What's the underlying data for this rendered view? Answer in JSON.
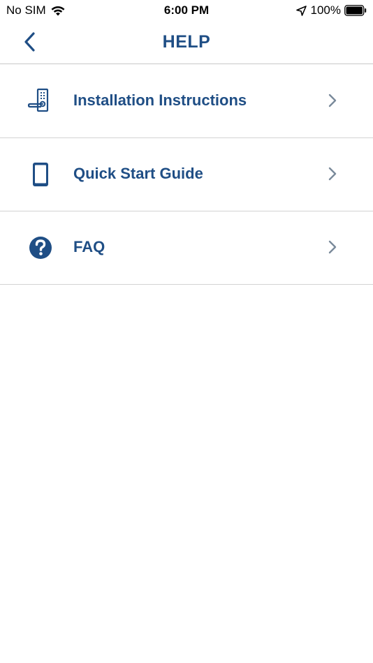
{
  "status_bar": {
    "carrier": "No SIM",
    "time": "6:00 PM",
    "battery": "100%"
  },
  "nav": {
    "title": "HELP",
    "back_icon": "chevron-left-icon"
  },
  "items": [
    {
      "label": "Installation Instructions",
      "icon": "door-lock-icon"
    },
    {
      "label": "Quick Start Guide",
      "icon": "smartphone-icon"
    },
    {
      "label": "FAQ",
      "icon": "question-circle-icon"
    }
  ],
  "colors": {
    "primary": "#1f4e85",
    "chevron": "#7a8a9a",
    "divider": "#d2d2d2"
  }
}
